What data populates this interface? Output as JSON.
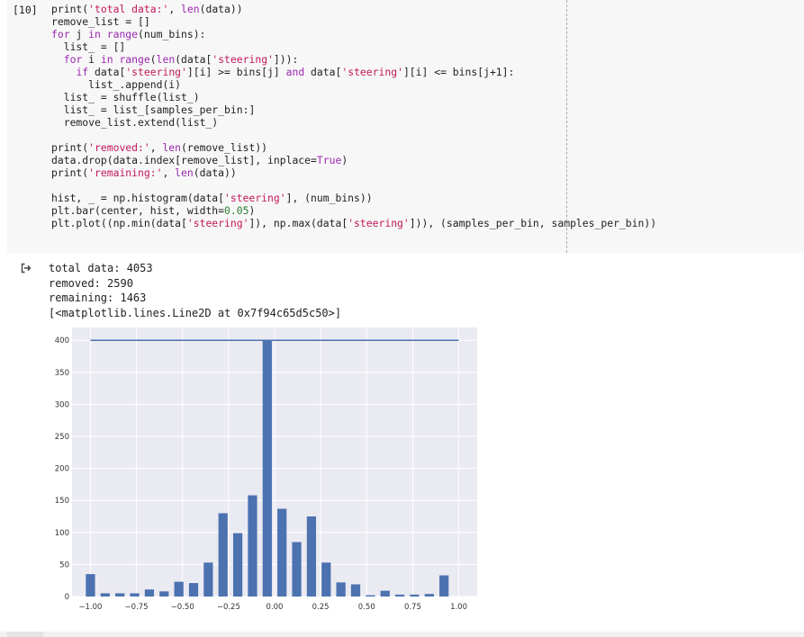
{
  "cell": {
    "execution_count": "[10]",
    "code_lines": [
      [
        [
          "t",
          "print("
        ],
        [
          "s",
          "'total data:'"
        ],
        [
          "t",
          ", "
        ],
        [
          "k",
          "len"
        ],
        [
          "t",
          "(data))"
        ]
      ],
      [
        [
          "t",
          "remove_list = []"
        ]
      ],
      [
        [
          "k",
          "for"
        ],
        [
          "t",
          " j "
        ],
        [
          "k",
          "in"
        ],
        [
          "t",
          " "
        ],
        [
          "k",
          "range"
        ],
        [
          "t",
          "(num_bins):"
        ]
      ],
      [
        [
          "t",
          "  list_ = []"
        ]
      ],
      [
        [
          "t",
          "  "
        ],
        [
          "k",
          "for"
        ],
        [
          "t",
          " i "
        ],
        [
          "k",
          "in"
        ],
        [
          "t",
          " "
        ],
        [
          "k",
          "range"
        ],
        [
          "t",
          "("
        ],
        [
          "k",
          "len"
        ],
        [
          "t",
          "(data["
        ],
        [
          "s",
          "'steering'"
        ],
        [
          "t",
          "])):"
        ]
      ],
      [
        [
          "t",
          "    "
        ],
        [
          "k",
          "if"
        ],
        [
          "t",
          " data["
        ],
        [
          "s",
          "'steering'"
        ],
        [
          "t",
          "][i] >= bins[j] "
        ],
        [
          "k",
          "and"
        ],
        [
          "t",
          " data["
        ],
        [
          "s",
          "'steering'"
        ],
        [
          "t",
          "][i] <= bins[j+1]:"
        ]
      ],
      [
        [
          "t",
          "      list_.append(i)"
        ]
      ],
      [
        [
          "t",
          "  list_ = shuffle(list_)"
        ]
      ],
      [
        [
          "t",
          "  list_ = list_[samples_per_bin:]"
        ]
      ],
      [
        [
          "t",
          "  remove_list.extend(list_)"
        ]
      ],
      [
        [
          "t",
          ""
        ]
      ],
      [
        [
          "t",
          "print("
        ],
        [
          "s",
          "'removed:'"
        ],
        [
          "t",
          ", "
        ],
        [
          "k",
          "len"
        ],
        [
          "t",
          "(remove_list))"
        ]
      ],
      [
        [
          "t",
          "data.drop(data.index[remove_list], inplace="
        ],
        [
          "c",
          "True"
        ],
        [
          "t",
          ")"
        ]
      ],
      [
        [
          "t",
          "print("
        ],
        [
          "s",
          "'remaining:'"
        ],
        [
          "t",
          ", "
        ],
        [
          "k",
          "len"
        ],
        [
          "t",
          "(data))"
        ]
      ],
      [
        [
          "t",
          ""
        ]
      ],
      [
        [
          "t",
          "hist, _ = np.histogram(data["
        ],
        [
          "s",
          "'steering'"
        ],
        [
          "t",
          "], (num_bins))"
        ]
      ],
      [
        [
          "t",
          "plt.bar(center, hist, width="
        ],
        [
          "n",
          "0.05"
        ],
        [
          "t",
          ")"
        ]
      ],
      [
        [
          "t",
          "plt.plot((np.min(data["
        ],
        [
          "s",
          "'steering'"
        ],
        [
          "t",
          "]), np.max(data["
        ],
        [
          "s",
          "'steering'"
        ],
        [
          "t",
          "])), (samples_per_bin, samples_per_bin))"
        ]
      ]
    ]
  },
  "output": {
    "icon": "output-arrow-icon",
    "lines": [
      "total data: 4053",
      "removed: 2590",
      "remaining: 1463",
      "[<matplotlib.lines.Line2D at 0x7f94c65d5c50>]"
    ]
  },
  "colors": {
    "cell_bg": "#f7f7f7",
    "plot_bg": "#eaeaf2",
    "bar": "#4c72b0",
    "keyword": "#9c27b0",
    "string": "#c2185b",
    "number": "#2e7d32"
  },
  "chart_data": {
    "type": "bar",
    "x": [
      -1.0,
      -0.92,
      -0.84,
      -0.76,
      -0.68,
      -0.6,
      -0.52,
      -0.44,
      -0.36,
      -0.28,
      -0.2,
      -0.12,
      -0.04,
      0.04,
      0.12,
      0.2,
      0.28,
      0.36,
      0.44,
      0.52,
      0.6,
      0.68,
      0.76,
      0.84,
      0.92,
      1.0
    ],
    "values": [
      35,
      5,
      5,
      5,
      11,
      8,
      23,
      21,
      53,
      130,
      99,
      158,
      400,
      137,
      85,
      125,
      53,
      22,
      19,
      2,
      9,
      3,
      3,
      4,
      33,
      0
    ],
    "bar_width": 0.05,
    "line": {
      "x": [
        -1.0,
        1.0
      ],
      "y": [
        400,
        400
      ]
    },
    "xlim": [
      -1.1,
      1.1
    ],
    "ylim": [
      0,
      420
    ],
    "xticks": [
      -1.0,
      -0.75,
      -0.5,
      -0.25,
      0.0,
      0.25,
      0.5,
      0.75,
      1.0
    ],
    "xtick_labels": [
      "−1.00",
      "−0.75",
      "−0.50",
      "−0.25",
      "0.00",
      "0.25",
      "0.50",
      "0.75",
      "1.00"
    ],
    "yticks": [
      0,
      50,
      100,
      150,
      200,
      250,
      300,
      350,
      400
    ],
    "ytick_labels": [
      "0",
      "50",
      "100",
      "150",
      "200",
      "250",
      "300",
      "350",
      "400"
    ],
    "grid": true
  }
}
